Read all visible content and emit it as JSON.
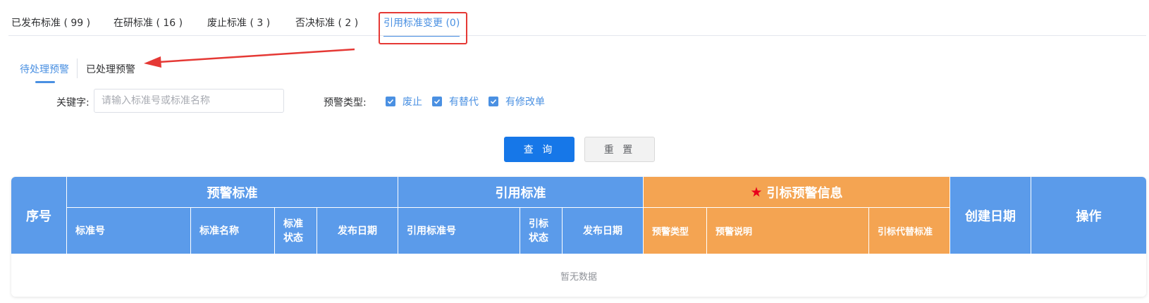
{
  "top_tabs": [
    {
      "label": "已发布标准 ( 99 )"
    },
    {
      "label": "在研标准 ( 16 )"
    },
    {
      "label": "废止标准 ( 3 )"
    },
    {
      "label": "否决标准 ( 2 )"
    },
    {
      "label": "引用标准变更 (0)",
      "active": true
    }
  ],
  "sub_tabs": [
    {
      "label": "待处理预警",
      "active": true
    },
    {
      "label": "已处理预警"
    }
  ],
  "filters": {
    "keyword_label": "关键字:",
    "keyword_placeholder": "请输入标准号或标准名称",
    "keyword_value": "",
    "warn_type_label": "预警类型:",
    "warn_types": [
      {
        "label": "废止",
        "checked": true
      },
      {
        "label": "有替代",
        "checked": true
      },
      {
        "label": "有修改单",
        "checked": true
      }
    ]
  },
  "buttons": {
    "query": "查 询",
    "reset": "重 置"
  },
  "table": {
    "col_index": "序号",
    "group_warning": "预警标准",
    "group_ref": "引用标准",
    "group_info": "引标预警信息",
    "col_created": "创建日期",
    "col_action": "操作",
    "warning_cols": [
      "标准号",
      "标准名称",
      "标准\n状态",
      "发布日期"
    ],
    "ref_cols": [
      "引用标准号",
      "引标\n状态",
      "发布日期"
    ],
    "info_cols": [
      "预警类型",
      "预警说明",
      "引标代替标准"
    ],
    "empty_text": "暂无数据"
  },
  "colors": {
    "accent": "#4a90e2",
    "header_blue": "#5b9bea",
    "header_orange": "#f4a452",
    "highlight": "#e53935"
  }
}
